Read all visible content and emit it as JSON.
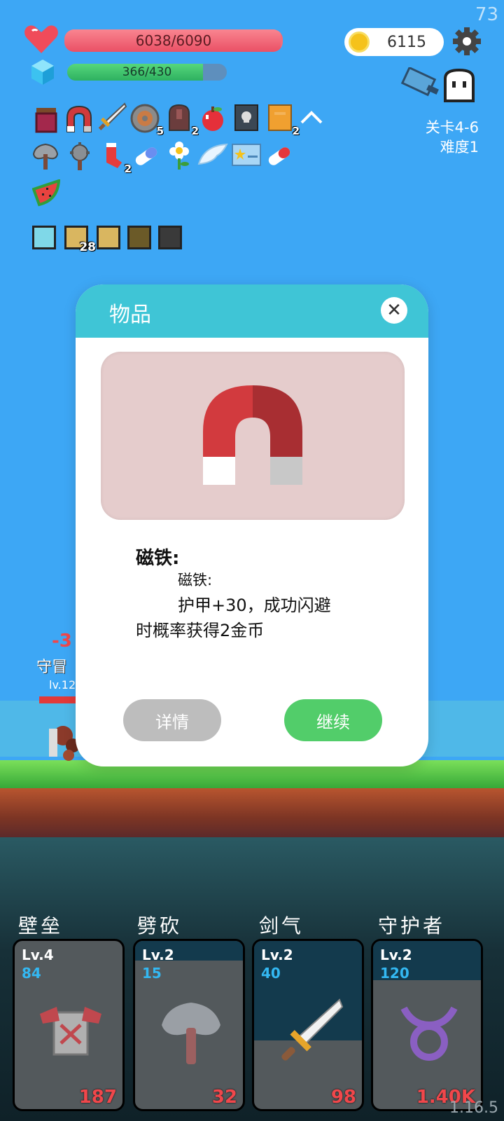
{
  "hud": {
    "fps": "73",
    "hp_text": "6038/6090",
    "hp_fraction": 0.9915,
    "mp_text": "366/430",
    "mp_fraction": 0.851,
    "gold": "6115",
    "stage": "关卡4-6",
    "difficulty": "难度1",
    "version": "1.16.5"
  },
  "inventory": {
    "row1": [
      {
        "icon": "jam-jar-icon",
        "count": ""
      },
      {
        "icon": "magnet-icon",
        "count": ""
      },
      {
        "icon": "sword-icon",
        "count": ""
      },
      {
        "icon": "round-shield-icon",
        "count": "5"
      },
      {
        "icon": "gravestone-icon",
        "count": "2"
      },
      {
        "icon": "apple-icon",
        "count": ""
      },
      {
        "icon": "skull-book-icon",
        "count": ""
      },
      {
        "icon": "orange-book-icon",
        "count": "2"
      }
    ],
    "row2": [
      {
        "icon": "battle-axe-icon",
        "count": ""
      },
      {
        "icon": "spiked-mace-icon",
        "count": ""
      },
      {
        "icon": "red-sock-icon",
        "count": "2"
      },
      {
        "icon": "blue-pill-icon",
        "count": ""
      },
      {
        "icon": "flower-icon",
        "count": ""
      },
      {
        "icon": "wing-icon",
        "count": ""
      },
      {
        "icon": "star-card-icon",
        "count": ""
      },
      {
        "icon": "red-pill-icon",
        "count": ""
      }
    ],
    "row3": [
      {
        "icon": "watermelon-icon",
        "count": ""
      }
    ],
    "skills": [
      {
        "icon": "light-skill-icon",
        "count": ""
      },
      {
        "icon": "armor-skill-icon",
        "count": "28"
      },
      {
        "icon": "shield-skill-icon",
        "count": ""
      },
      {
        "icon": "dark-skill-icon",
        "count": ""
      },
      {
        "icon": "black-shield-skill-icon",
        "count": ""
      }
    ]
  },
  "enemy": {
    "damage": "-3",
    "name": "守冒",
    "level": "lv.12"
  },
  "modal": {
    "title": "物品",
    "item_name": "磁铁:",
    "desc_sub": "磁铁:",
    "desc_line1": "护甲+30，成功闪避",
    "desc_line2": "时概率获得2金币",
    "detail_label": "详情",
    "continue_label": "继续"
  },
  "cards": [
    {
      "title": "壁垒",
      "lv": "Lv.4",
      "num": "84",
      "value": "187",
      "icon": "armor-icon"
    },
    {
      "title": "劈砍",
      "lv": "Lv.2",
      "num": "15",
      "value": "32",
      "icon": "axe-icon"
    },
    {
      "title": "剑气",
      "lv": "Lv.2",
      "num": "40",
      "value": "98",
      "icon": "sword-icon"
    },
    {
      "title": "守护者",
      "lv": "Lv.2",
      "num": "120",
      "value": "1.40K",
      "icon": "taurus-icon"
    }
  ],
  "colors": {
    "sky": "#3da7f5",
    "hp": "#f26d7a",
    "mp": "#2eb160",
    "modal_header": "#3fc5d6",
    "continue": "#52cd6a",
    "detail": "#bdbdbd",
    "card_number": "#33b8f2",
    "card_value": "#f0474b"
  }
}
